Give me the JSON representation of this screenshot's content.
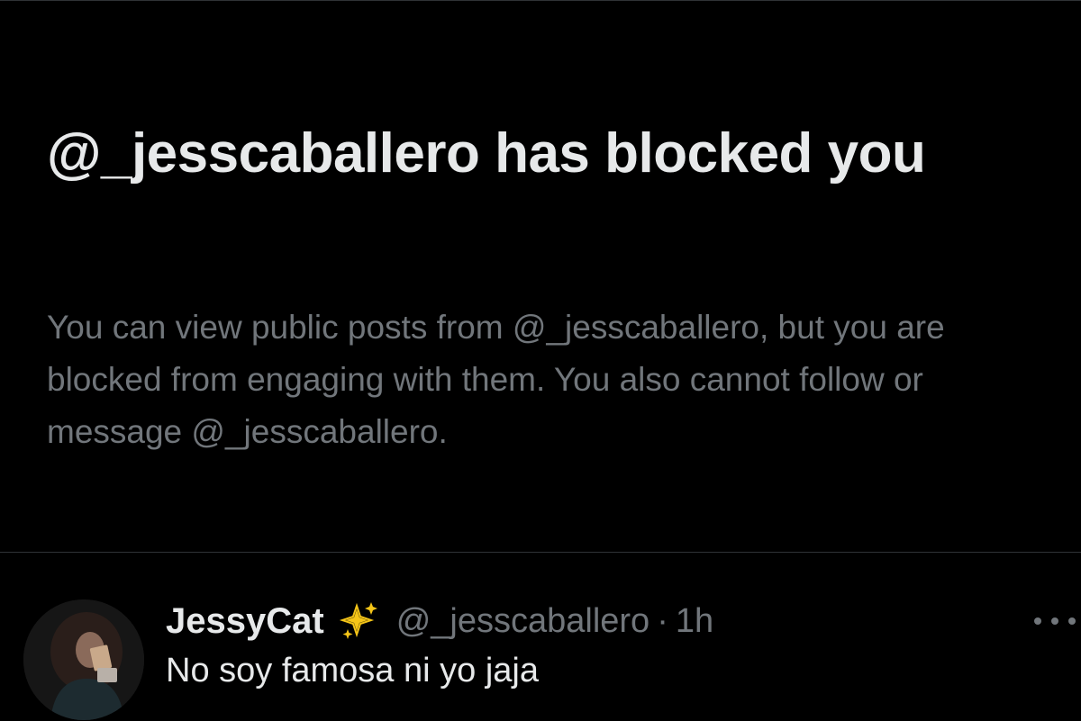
{
  "blocked_notice": {
    "title": "@_jesscaballero has blocked you",
    "description": "You can view public posts from @_jesscaballero, but you are blocked from engaging with them. You also cannot follow or message @_jesscaballero."
  },
  "post": {
    "display_name": "JessyCat",
    "name_emoji_icon": "sparkles-icon",
    "handle": "@_jesscaballero",
    "separator": "·",
    "timestamp": "1h",
    "text": "No soy famosa ni yo jaja",
    "more_icon": "more-horizontal-icon"
  },
  "colors": {
    "background": "#000000",
    "primary_text": "#e7e9ea",
    "secondary_text": "#71767b",
    "divider": "#2f3336",
    "sparkle": "#f5c518"
  }
}
